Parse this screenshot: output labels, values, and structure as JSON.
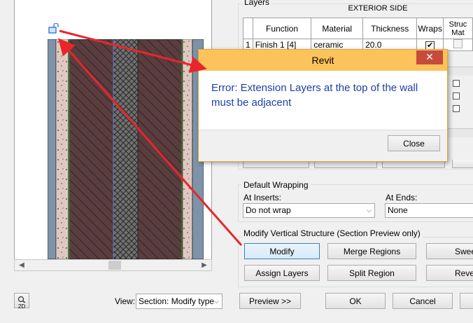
{
  "layers": {
    "group_title": "Layers",
    "exterior_side": "EXTERIOR SIDE",
    "columns": [
      "Function",
      "Material",
      "Thickness",
      "Wraps",
      "Struc Mat"
    ],
    "rows": [
      {
        "num": "1",
        "function": "Finish 1 [4]",
        "material": "ceramic",
        "thickness": "20.0",
        "wraps": true
      }
    ]
  },
  "dialog": {
    "title": "Revit",
    "close_x": "✕",
    "message": "Error: Extension Layers at the top of the wall must be adjacent",
    "close_button": "Close"
  },
  "wrapping": {
    "title": "Default Wrapping",
    "at_inserts_label": "At Inserts:",
    "at_inserts_value": "Do not wrap",
    "at_ends_label": "At  Ends:",
    "at_ends_value": "None"
  },
  "vertical": {
    "title": "Modify Vertical Structure (Section Preview only)",
    "modify": "Modify",
    "merge_regions": "Merge Regions",
    "sweeps": "Swee",
    "assign_layers": "Assign Layers",
    "split_region": "Split Region",
    "reveals": "Reve"
  },
  "footer": {
    "view_label": "View:",
    "view_value": "Section: Modify type",
    "preview": "Preview >>",
    "ok": "OK",
    "cancel": "Cancel"
  },
  "icons": {
    "zoom": "2D"
  },
  "colors": {
    "dialog_title_bg": "#fbc35a",
    "dialog_close_bg": "#c74b3c",
    "message_text": "#1b3fa6",
    "arrow": "#e8262b"
  }
}
